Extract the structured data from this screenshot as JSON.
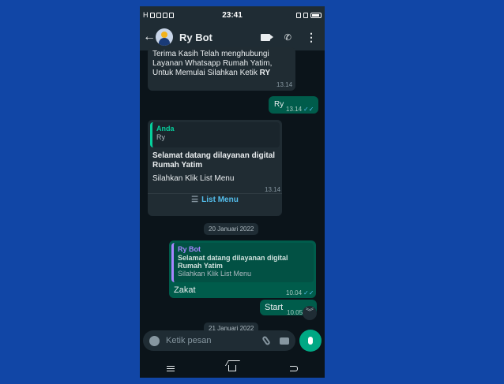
{
  "status": {
    "time": "23:41"
  },
  "header": {
    "title": "Ry Bot"
  },
  "messages": {
    "m1": {
      "text": "Terima Kasih Telah menghubungi Layanan Whatsapp Rumah Yatim, Untuk Memulai Silahkan Ketik",
      "bold": "RY",
      "time": "13.14"
    },
    "m2": {
      "text": "Ry",
      "time": "13.14"
    },
    "m3": {
      "quote_name": "Anda",
      "quote_text": "Ry",
      "title": "Selamat datang dilayanan digital Rumah Yatim",
      "body": "Silahkan Klik List Menu",
      "time": "13.14",
      "button": "List Menu"
    },
    "date1": "20 Januari 2022",
    "m4": {
      "quote_name": "Ry Bot",
      "quote_title": "Selamat datang dilayanan digital Rumah Yatim",
      "quote_text": "Silahkan Klik List Menu",
      "text": "Zakat",
      "time": "10.04"
    },
    "m5": {
      "text": "Start",
      "time": "10.05"
    },
    "date2": "21 Januari 2022"
  },
  "input": {
    "placeholder": "Ketik pesan"
  }
}
